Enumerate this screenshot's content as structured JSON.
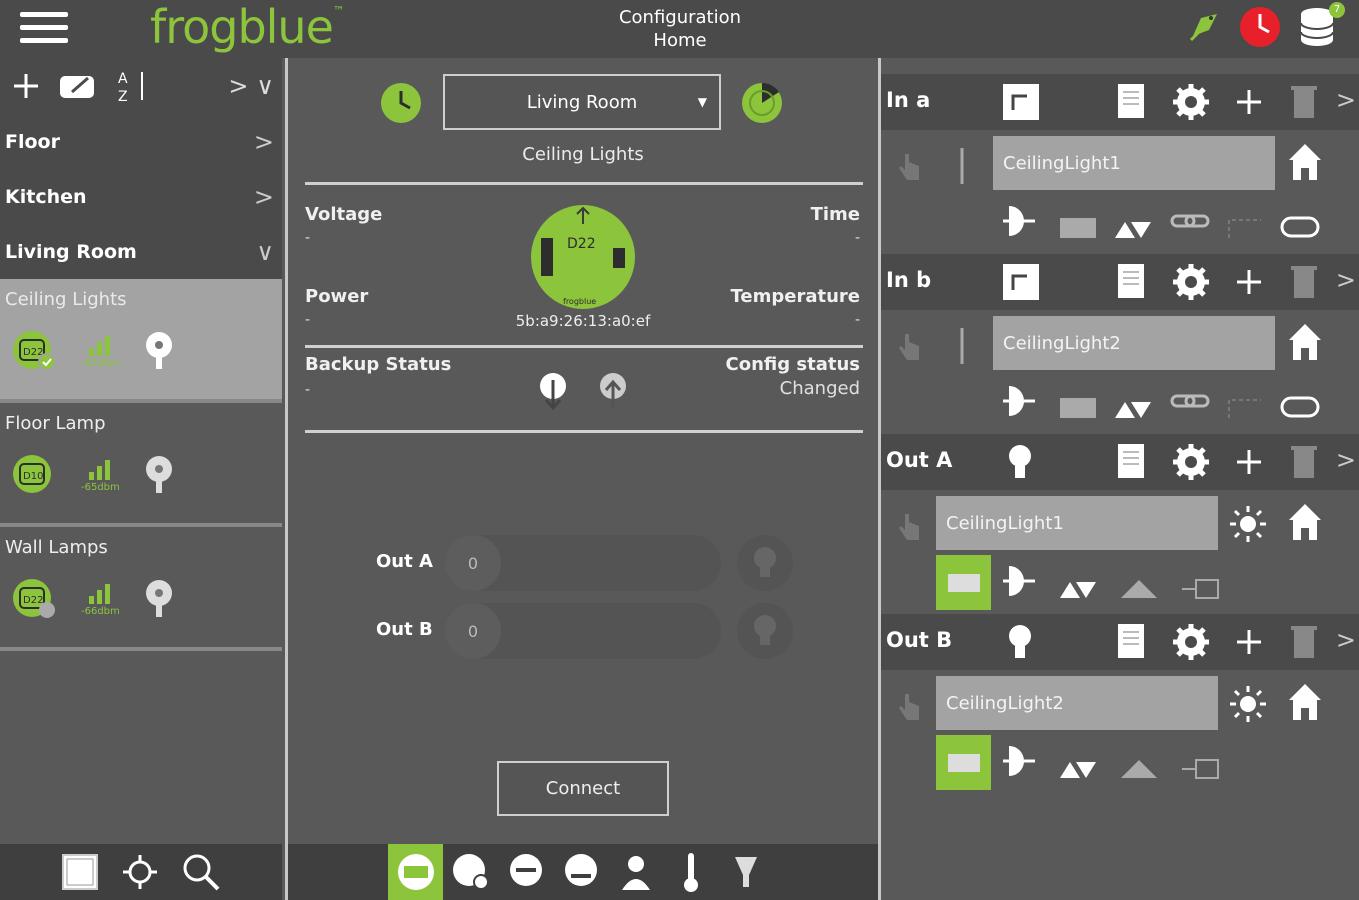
{
  "header": {
    "logo_text": "frogblue",
    "logo_tm": "™",
    "title": "Configuration",
    "subtitle": "Home",
    "notification_badge": "7"
  },
  "left": {
    "nav": [
      {
        "label": "Floor"
      },
      {
        "label": "Kitchen"
      },
      {
        "label": "Living Room"
      }
    ],
    "devices": [
      {
        "name": "Ceiling Lights",
        "chip": "D22",
        "signal": "-65dbm"
      },
      {
        "name": "Floor Lamp",
        "chip": "D10",
        "signal": "-65dbm"
      },
      {
        "name": "Wall Lamps",
        "chip": "D22",
        "signal": "-66dbm"
      }
    ]
  },
  "middle": {
    "room": "Living Room",
    "device_title": "Ceiling Lights",
    "voltage_label": "Voltage",
    "voltage_value": "-",
    "time_label": "Time",
    "time_value": "-",
    "power_label": "Power",
    "power_value": "-",
    "temperature_label": "Temperature",
    "temperature_value": "-",
    "chip_label": "D22",
    "chip_brand": "frogblue",
    "mac": "5b:a9:26:13:a0:ef",
    "backup_label": "Backup Status",
    "backup_value": "-",
    "config_label": "Config status",
    "config_value": "Changed",
    "outputs": [
      {
        "label": "Out A",
        "value": "0"
      },
      {
        "label": "Out B",
        "value": "0"
      }
    ],
    "connect_label": "Connect"
  },
  "right": {
    "sections": [
      {
        "label": "In a",
        "field": "CeilingLight1"
      },
      {
        "label": "In b",
        "field": "CeilingLight2"
      },
      {
        "label": "Out A",
        "field": "CeilingLight1"
      },
      {
        "label": "Out B",
        "field": "CeilingLight2"
      }
    ]
  },
  "colors": {
    "accent": "#8cc43c",
    "topbar": "#4a4a4a",
    "panel": "#595959",
    "selected": "#a3a3a3",
    "alarm": "#e8202a"
  }
}
